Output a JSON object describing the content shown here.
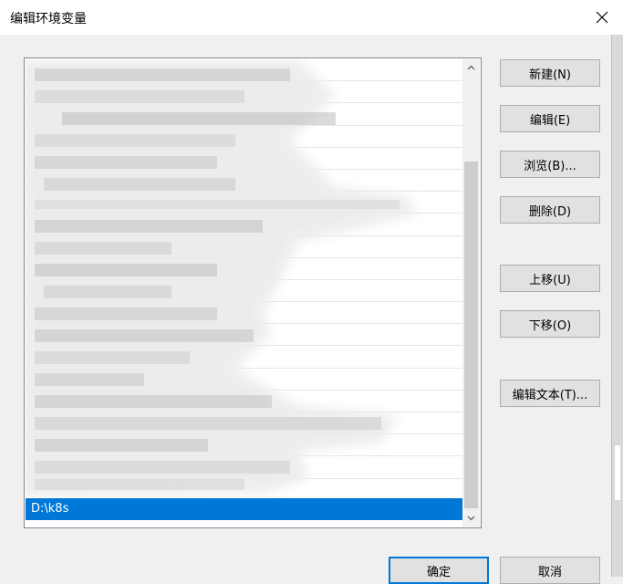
{
  "window": {
    "title": "编辑环境变量"
  },
  "list": {
    "selected_item": "D:\\k8s"
  },
  "buttons": {
    "new": "新建(N)",
    "edit": "编辑(E)",
    "browse": "浏览(B)...",
    "delete": "删除(D)",
    "move_up": "上移(U)",
    "move_down": "下移(O)",
    "edit_text": "编辑文本(T)...",
    "ok": "确定",
    "cancel": "取消"
  },
  "colors": {
    "selection": "#0078d7",
    "window_bg": "#f0f0f0",
    "button_bg": "#e1e1e1"
  }
}
